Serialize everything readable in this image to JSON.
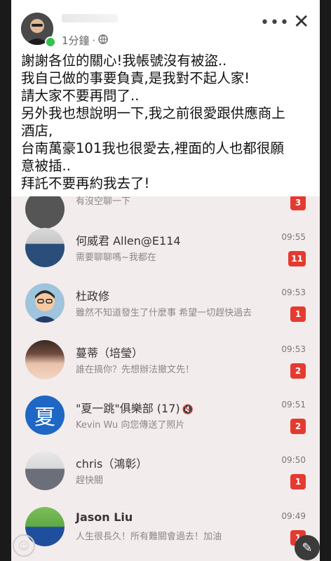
{
  "post": {
    "time_label": "1分鐘",
    "separator": "·",
    "lines": [
      "謝謝各位的關心!我帳號沒有被盜..",
      "我自己做的事要負責,是我對不起人家!",
      "請大家不要再問了..",
      "另外我也想說明一下,我之前很愛跟供應商上",
      "酒店,",
      "台南萬豪101我也很愛去,裡面的人也都很願",
      "意被插..",
      "拜託不要再約我去了!"
    ]
  },
  "icons": {
    "more": "more-dots-icon",
    "close": "close-icon",
    "globe": "globe-icon",
    "compose": "pencil-icon",
    "emoji": "smile-icon",
    "mute": "mute-icon"
  },
  "chats": [
    {
      "name": "",
      "message": "有沒空聊一下",
      "time": "",
      "badge": "3"
    },
    {
      "name": "何威君 Allen@E114",
      "message": "需要聊聊嗎~我都在",
      "time": "09:55",
      "badge": "11"
    },
    {
      "name": "杜政修",
      "message": "雖然不知道發生了什麼事 希望一切趕快過去",
      "time": "09:53",
      "badge": "1"
    },
    {
      "name": "蔓蒂（培瑩）",
      "message": "誰在搞你？先想辦法撤文先！",
      "time": "09:53",
      "badge": "2"
    },
    {
      "name": "\"夏一跳\"俱樂部 (17)",
      "avatar_text": "夏",
      "message": "Kevin Wu 向您傳送了照片",
      "time": "09:51",
      "badge": "2"
    },
    {
      "name": "chris（鴻彰）",
      "message": "趕快關",
      "time": "09:50",
      "badge": "1"
    },
    {
      "name": "Jason Liu",
      "message": "人生很長久！所有難關會過去！加油",
      "time": "09:49",
      "badge": "1"
    }
  ],
  "colors": {
    "badge": "#e53a2f",
    "online": "#31c24b",
    "group_avatar": "#1e67c4"
  }
}
